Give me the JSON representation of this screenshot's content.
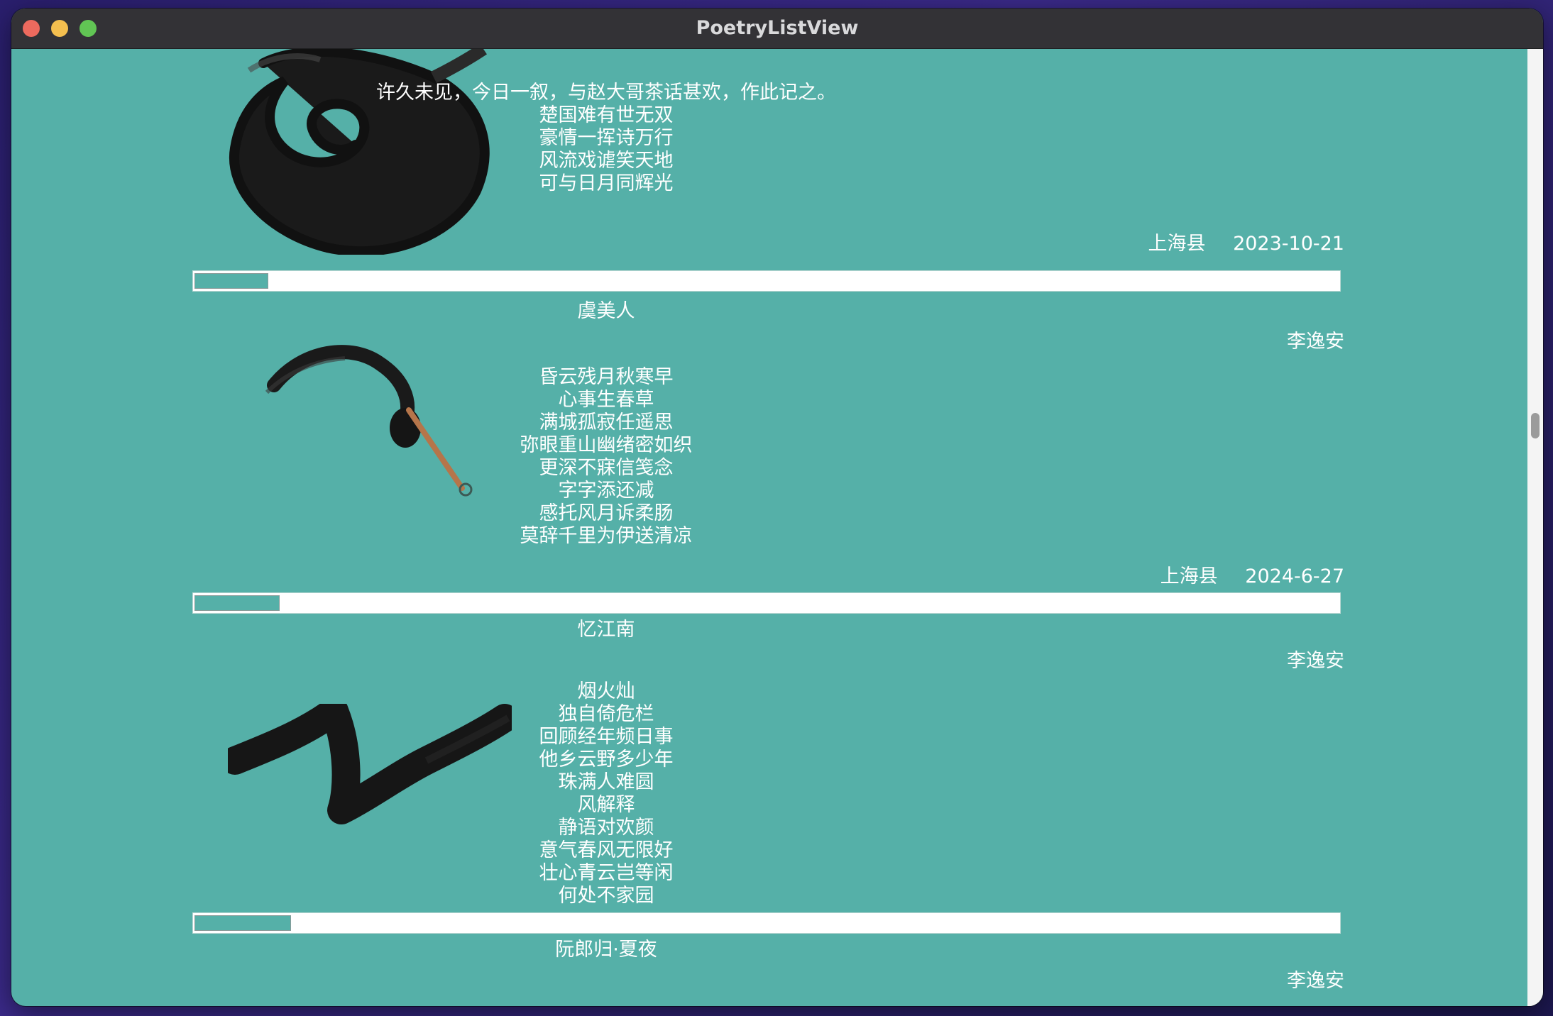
{
  "window": {
    "title": "PoetryListView"
  },
  "poems": [
    {
      "title": "",
      "author": "",
      "lines": [
        "许久未见，今日一叙，与赵大哥茶话甚欢，作此记之。",
        "楚国难有世无双",
        "豪情一挥诗万行",
        "风流戏谑笑天地",
        "可与日月同辉光"
      ],
      "location": "上海县",
      "date": "2023-10-21",
      "image_icon": "ink-swirl-icon",
      "progress": 0.065
    },
    {
      "title": "虞美人",
      "author": "李逸安",
      "lines": [
        "昏云残月秋寒早",
        "心事生春草",
        "满城孤寂任遥思",
        "弥眼重山幽绪密如织",
        "更深不寐信笺念",
        "字字添还减",
        "感托风月诉柔肠",
        "莫辞千里为伊送清凉"
      ],
      "location": "上海县",
      "date": "2024-6-27",
      "image_icon": "ink-brush-icon",
      "progress": 0.075
    },
    {
      "title": "忆江南",
      "author": "李逸安",
      "lines": [
        "烟火灿",
        "独自倚危栏",
        "回顾经年频日事",
        "他乡云野多少年",
        "珠满人难圆",
        "风解释",
        "静语对欢颜",
        "意气春风无限好",
        "壮心青云岂等闲",
        "何处不家园"
      ],
      "location": "",
      "date": "",
      "image_icon": "ink-stroke-icon",
      "progress": 0.085
    },
    {
      "title": "阮郎归·夏夜",
      "author": "李逸安"
    }
  ],
  "colors": {
    "background": "#55b0a8",
    "text": "#ffffff",
    "titlebar": "#333236"
  }
}
